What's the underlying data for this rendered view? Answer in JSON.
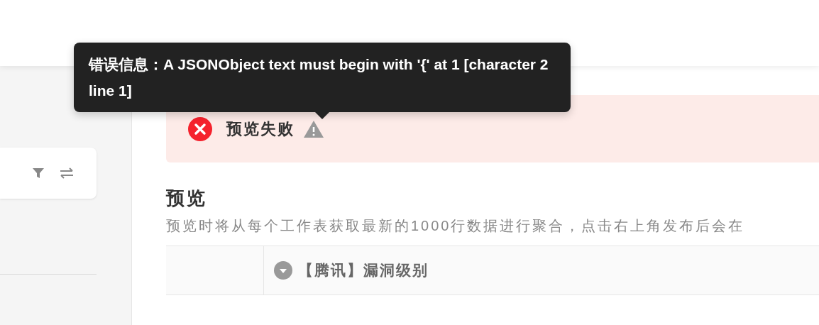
{
  "tooltip": {
    "text": "错误信息：A JSONObject text must begin with '{' at 1 [character 2 line 1]"
  },
  "alert": {
    "kind": "error",
    "message": "预览失败"
  },
  "preview": {
    "title": "预览",
    "description": "预览时将从每个工作表获取最新的1000行数据进行聚合，点击右上角发布后会在"
  },
  "table": {
    "columns": [
      "",
      "【腾讯】漏洞级别"
    ]
  }
}
